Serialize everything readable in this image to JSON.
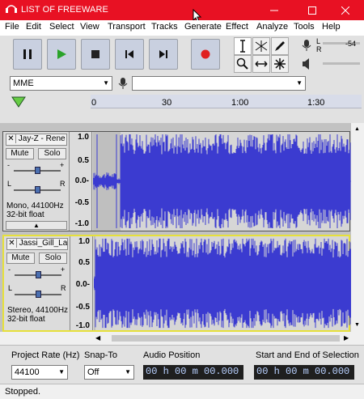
{
  "window": {
    "title": "LIST OF FREEWARE"
  },
  "menu": [
    "File",
    "Edit",
    "Select",
    "View",
    "Transport",
    "Tracks",
    "Generate",
    "Effect",
    "Analyze",
    "Tools",
    "Help"
  ],
  "meter": {
    "l_label": "L",
    "r_label": "R",
    "db_label": "-54"
  },
  "device": {
    "host": "MME"
  },
  "timeline": {
    "ticks": [
      "0",
      "30",
      "1:00",
      "1:30"
    ]
  },
  "tracks": [
    {
      "name": "Jay-Z - Rene",
      "mute": "Mute",
      "solo": "Solo",
      "info_line1": "Mono, 44100Hz",
      "info_line2": "32-bit float",
      "scale": [
        "1.0",
        "0.5",
        "0.0-",
        "-0.5",
        "-1.0"
      ]
    },
    {
      "name": "Jassi_Gill_La",
      "mute": "Mute",
      "solo": "Solo",
      "info_line1": "Stereo, 44100Hz",
      "info_line2": "32-bit float",
      "scale": [
        "1.0",
        "0.5",
        "0.0-",
        "-0.5",
        "-1.0"
      ]
    }
  ],
  "selection": {
    "project_rate_label": "Project Rate (Hz)",
    "project_rate_value": "44100",
    "snap_label": "Snap-To",
    "snap_value": "Off",
    "audio_position_label": "Audio Position",
    "audio_position_value": "00 h 00 m 00.000 s",
    "sel_label": "Start and End of Selection",
    "sel_value": "00 h 00 m 00.000 s"
  },
  "status": "Stopped.",
  "colors": {
    "titlebar": "#e81123",
    "waveform": "#3b3bd0",
    "selected_border": "#e6e03a"
  }
}
